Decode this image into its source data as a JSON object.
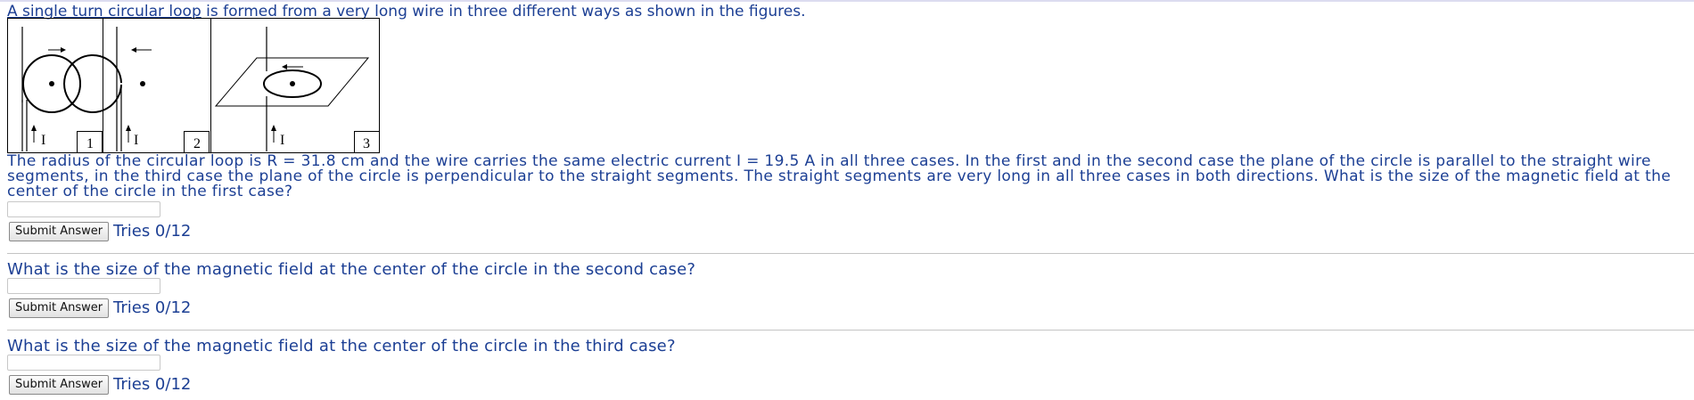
{
  "problem": {
    "intro_underlined": "A single turn circular loop",
    "intro_rest": " is formed from a very long wire in three different ways as shown in the figures.",
    "figure": {
      "current_label": "I",
      "panel_labels": [
        "1",
        "2",
        "3"
      ]
    },
    "paragraph": "The radius of the circular loop is R = 31.8 cm and the wire carries the same electric current I = 19.5 A in all three cases. In the first and in the second case the plane of the circle is parallel to the straight wire segments, in the third case the plane of the circle is perpendicular to the straight segments. The straight segments are very long in all three cases in both directions. What is the size of the magnetic field at the center of the circle in the first case?"
  },
  "parts": [
    {
      "question": "",
      "answer_value": "",
      "submit_label": "Submit Answer",
      "tries": "Tries 0/12"
    },
    {
      "question": "What is the size of the magnetic field at the center of the circle in the second case?",
      "answer_value": "",
      "submit_label": "Submit Answer",
      "tries": "Tries 0/12"
    },
    {
      "question": "What is the size of the magnetic field at the center of the circle in the third case?",
      "answer_value": "",
      "submit_label": "Submit Answer",
      "tries": "Tries 0/12"
    }
  ]
}
